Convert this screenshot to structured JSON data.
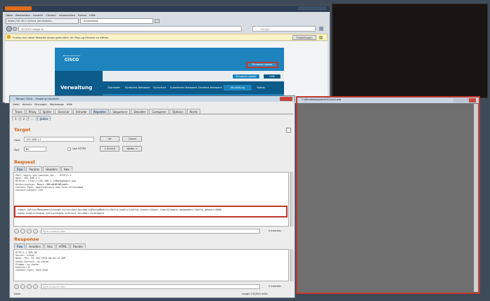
{
  "firefox": {
    "title": "Mozilla Firefox",
    "menu": [
      "Datei",
      "Bearbeiten",
      "Ansicht",
      "Chronik",
      "Lesezeichen",
      "Extras",
      "Hilfe"
    ],
    "tabs": [
      "https://10.20.0.1/cisco_services/cs...",
      "Anmeldung"
    ],
    "url": "10.20.0.1/sign-in",
    "notice": "Firefox hat diese Website daran gehindert, ein Pop-up-Fenster zu öffnen.",
    "notice_button": "Einstellungen",
    "search_placeholder": "Google"
  },
  "cisco": {
    "logo_text": "CISCO",
    "section": "Verwaltung",
    "top_buttons": [
      "Firmware-Update",
      "Hilfe"
    ],
    "nav": [
      "Startseite",
      "Einfaches Netzwerk",
      "Sicherheit",
      "Erweitertes Netzwerk",
      "Drahtlos-Netzwerk",
      "Verwaltung",
      "Status"
    ]
  },
  "tamper": {
    "title": "Tamper Data - Ongoing requests",
    "menu": [
      "Datei",
      "Ansicht",
      "Sitzungen",
      "Werkzeuge",
      "Hilfe"
    ],
    "toolbar_tabs": [
      "Trace",
      "Proxy",
      "Spider",
      "Scanner",
      "Intruder",
      "Repeater",
      "Sequencer",
      "Decoder",
      "Comparer",
      "Options",
      "Alerts"
    ],
    "subtabs": [
      "1",
      "2",
      "...",
      "Jeden"
    ],
    "target_header": "Target",
    "host_label": "Host",
    "host_value": "192.168.1.1",
    "port_label": "Port",
    "port_value": "80",
    "https_label": "Use HTTPS",
    "go_button": "Go",
    "cancel_button": "Cancel",
    "prev_button": "< Zurück",
    "next_button": "Weiter >",
    "request_header": "Request",
    "request_tabs": [
      "Raw",
      "Params",
      "Headers",
      "Hex"
    ],
    "request_lines": [
      "POST /apply.cgi;session_id=... HTTP/1.1",
      "Host: 192.168.1.1",
      "Referer: http://192.168.1.1/Management.asp",
      "Authorization: Basic YWRtaW46YWRtaW4=",
      "Content-Type: application/x-www-form-urlencoded",
      "Content-Length: 233"
    ],
    "request_highlight_1": "submit_button=Management&change_action=&action=Apply&PasswdModify=1&http_enable=1&https_enable=1&wait_time=4&remote_management=1&http_wanport=8080",
    "request_highlight_2": "&upnp_enable=1&upnp_config=1&upnp_internet_dis=0&wl_ssid=Apple",
    "search_placeholder": "Type a search term",
    "matches_label": "0 matches",
    "response_header": "Response",
    "response_tabs": [
      "Raw",
      "Headers",
      "Hex",
      "HTML",
      "Render"
    ],
    "response_lines": [
      "HTTP/1.1 200 OK",
      "Server: httpd",
      "Date: Thu, 01 Jan 1970 00:03:14 GMT",
      "Cache-Control: no-cache",
      "Pragma: no-cache",
      "Expires: 0",
      "Content-Type: text/html"
    ],
    "status": "Done",
    "status_right": "Length 133,823 millis"
  },
  "cmd": {
    "title": "C:\\Windows\\system32\\cmd.exe"
  },
  "colors": {
    "highlight_box": "#c0392b",
    "cisco_blue": "#1d84be",
    "cisco_dark": "#0b5c8a",
    "burp_orange": "#d06010"
  }
}
